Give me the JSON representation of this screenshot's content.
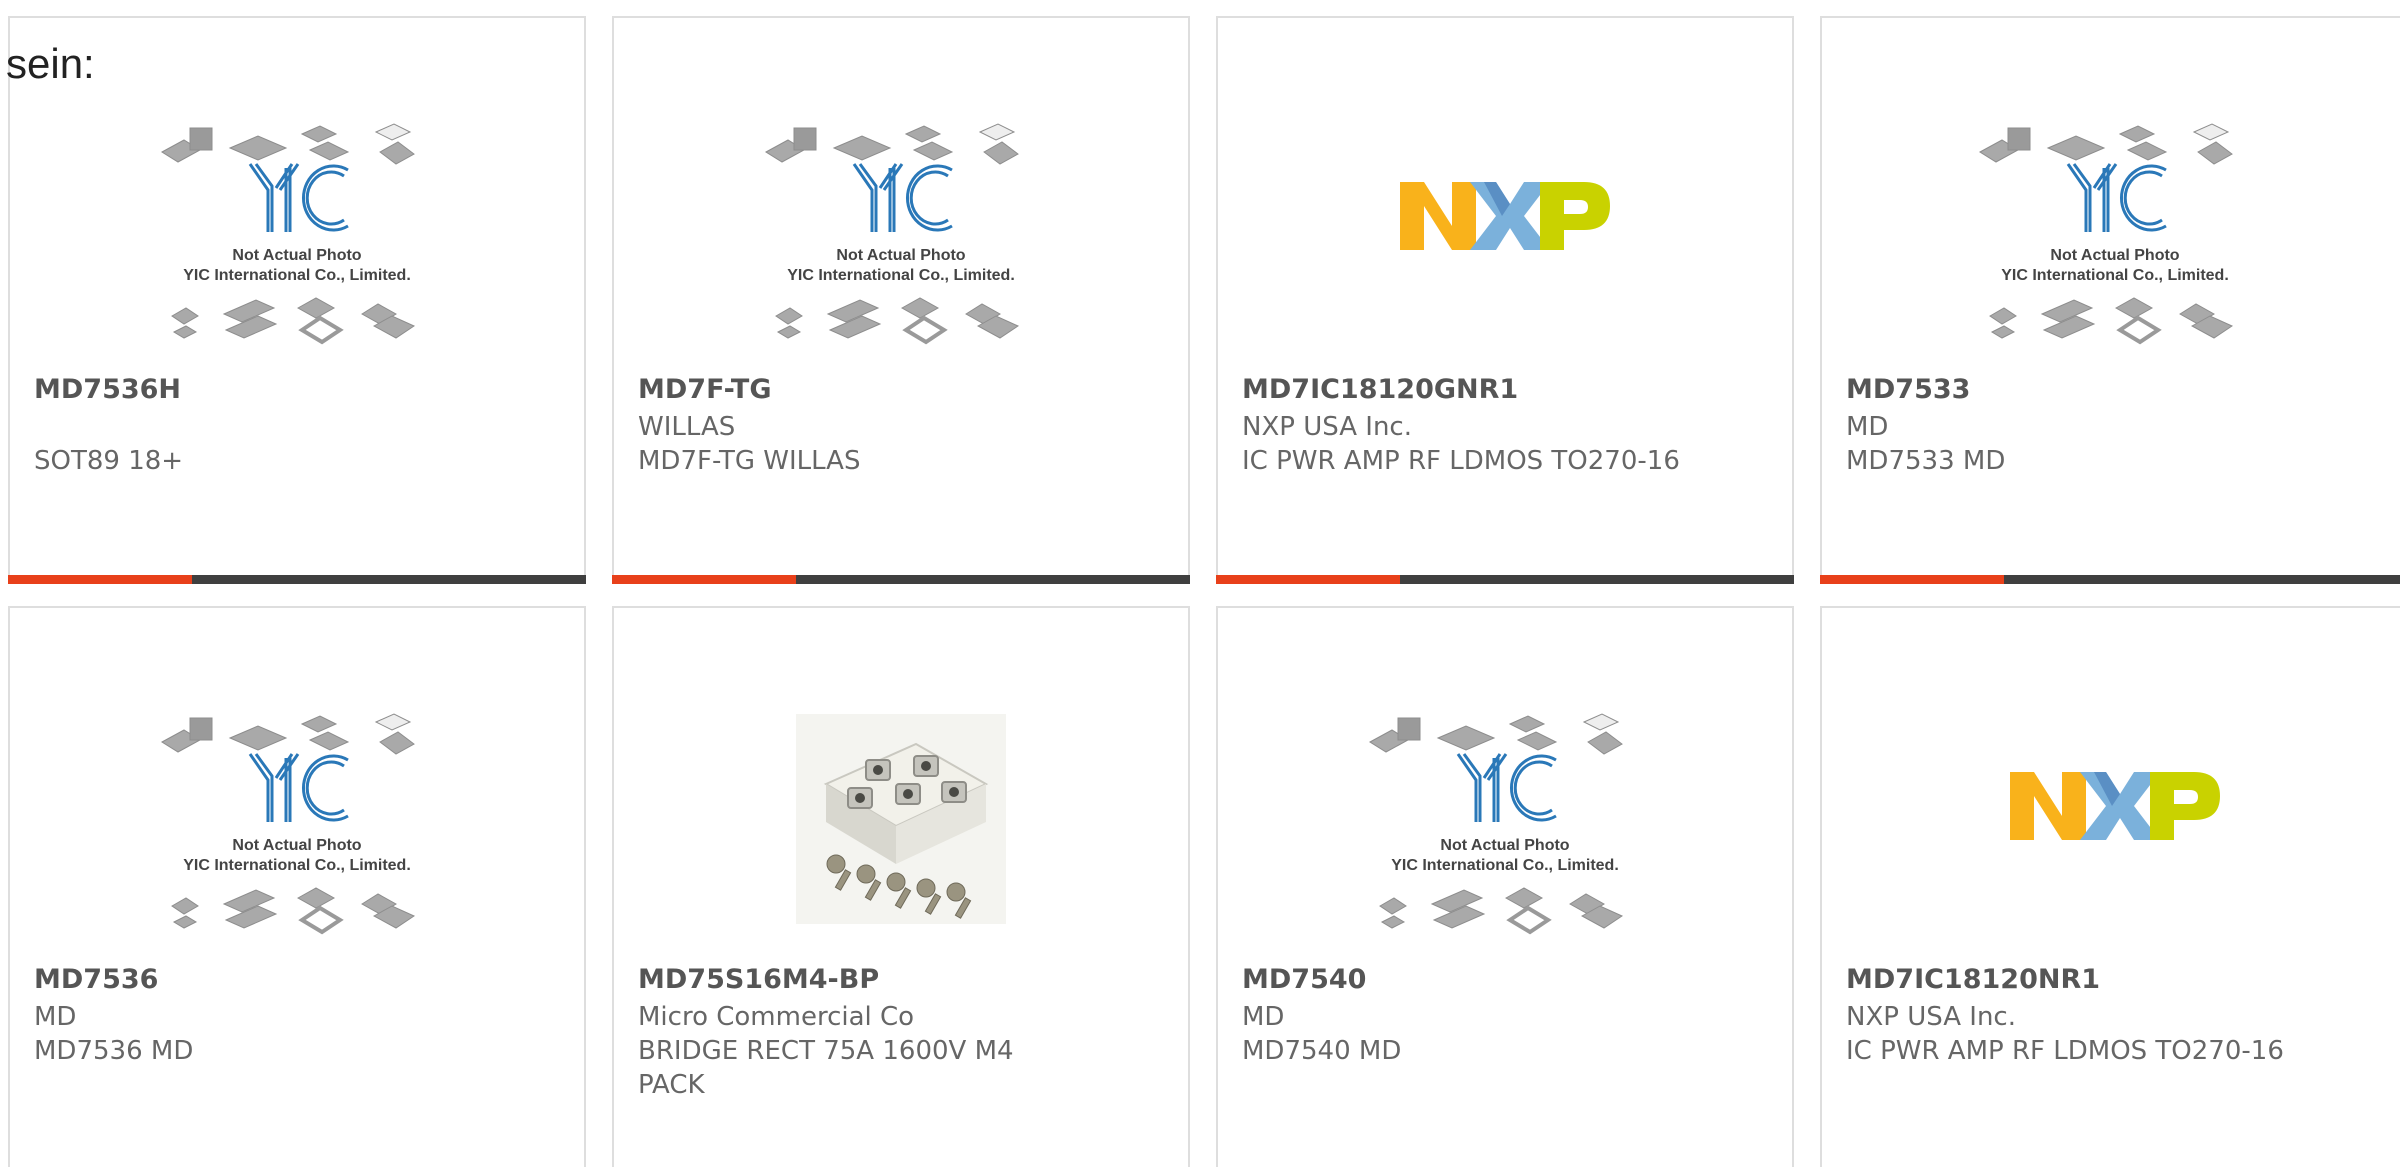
{
  "prefix_text": "sein:",
  "cards": [
    {
      "part": "MD7536H",
      "manufacturer": "",
      "description": "SOT89 18+",
      "image": "yic-placeholder",
      "placeholder_line1": "Not Actual Photo",
      "placeholder_line2": "YIC International Co., Limited."
    },
    {
      "part": "MD7F-TG",
      "manufacturer": "WILLAS",
      "description": "MD7F-TG WILLAS",
      "image": "yic-placeholder",
      "placeholder_line1": "Not Actual Photo",
      "placeholder_line2": "YIC International Co., Limited."
    },
    {
      "part": "MD7IC18120GNR1",
      "manufacturer": "NXP USA Inc.",
      "description": "IC PWR AMP RF LDMOS TO270-16",
      "image": "nxp-logo"
    },
    {
      "part": "MD7533",
      "manufacturer": "MD",
      "description": "MD7533 MD",
      "image": "yic-placeholder",
      "placeholder_line1": "Not Actual Photo",
      "placeholder_line2": "YIC International Co., Limited."
    },
    {
      "part": "MD7536",
      "manufacturer": "MD",
      "description": "MD7536 MD",
      "image": "yic-placeholder",
      "placeholder_line1": "Not Actual Photo",
      "placeholder_line2": "YIC International Co., Limited."
    },
    {
      "part": "MD75S16M4-BP",
      "manufacturer": "Micro Commercial Co",
      "description": "BRIDGE RECT 75A 1600V M4 PACK",
      "image": "bridge-module-photo"
    },
    {
      "part": "MD7540",
      "manufacturer": "MD",
      "description": "MD7540 MD",
      "image": "yic-placeholder",
      "placeholder_line1": "Not Actual Photo",
      "placeholder_line2": "YIC International Co., Limited."
    },
    {
      "part": "MD7IC18120NR1",
      "manufacturer": "NXP USA Inc.",
      "description": "IC PWR AMP RF LDMOS TO270-16",
      "image": "nxp-logo"
    }
  ],
  "colors": {
    "accent": "#e8401a",
    "bar": "#3f3f3f",
    "border": "#dedede",
    "yic_blue": "#2a78b8",
    "nxp_orange": "#f9b21b",
    "nxp_blue": "#7bb1db",
    "nxp_green": "#c9d200"
  }
}
